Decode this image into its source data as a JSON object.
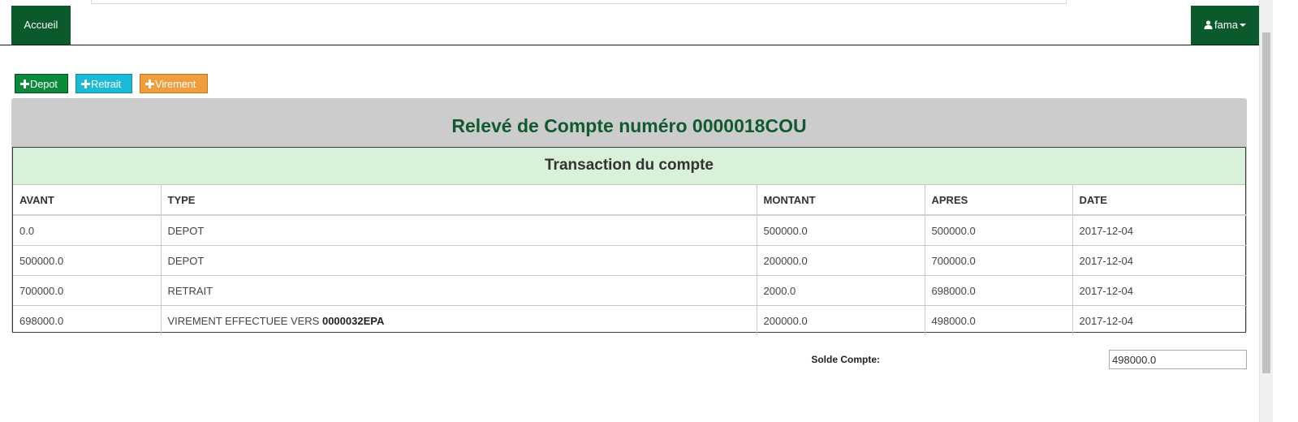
{
  "navbar": {
    "home_label": "Accueil",
    "user_label": "fama",
    "user_icon": "user-icon",
    "caret_icon": "caret-down-icon"
  },
  "actions": {
    "depot_label": "Depot",
    "retrait_label": "Retrait",
    "virement_label": "Virement",
    "plus_icon": "plus-icon"
  },
  "statement": {
    "title": "Relevé de Compte numéro 0000018COU",
    "subtitle": "Transaction du compte",
    "columns": [
      "AVANT",
      "TYPE",
      "MONTANT",
      "APRES",
      "DATE"
    ],
    "rows": [
      {
        "avant": "0.0",
        "type": "DEPOT",
        "type_ref": "",
        "montant": "500000.0",
        "apres": "500000.0",
        "date": "2017-12-04"
      },
      {
        "avant": "500000.0",
        "type": "DEPOT",
        "type_ref": "",
        "montant": "200000.0",
        "apres": "700000.0",
        "date": "2017-12-04"
      },
      {
        "avant": "700000.0",
        "type": "RETRAIT",
        "type_ref": "",
        "montant": "2000.0",
        "apres": "698000.0",
        "date": "2017-12-04"
      },
      {
        "avant": "698000.0",
        "type": "VIREMENT EFFECTUEE VERS ",
        "type_ref": "0000032EPA",
        "montant": "200000.0",
        "apres": "498000.0",
        "date": "2017-12-04"
      }
    ]
  },
  "balance": {
    "label": "Solde Compte:",
    "value": "498000.0"
  },
  "colors": {
    "brand_green": "#0b5a2c",
    "depot": "#0a8a3a",
    "retrait": "#1bbad6",
    "virement": "#f29d3d",
    "subtitle_bg": "#d9f0d9",
    "panel_bg": "#cccccc"
  }
}
